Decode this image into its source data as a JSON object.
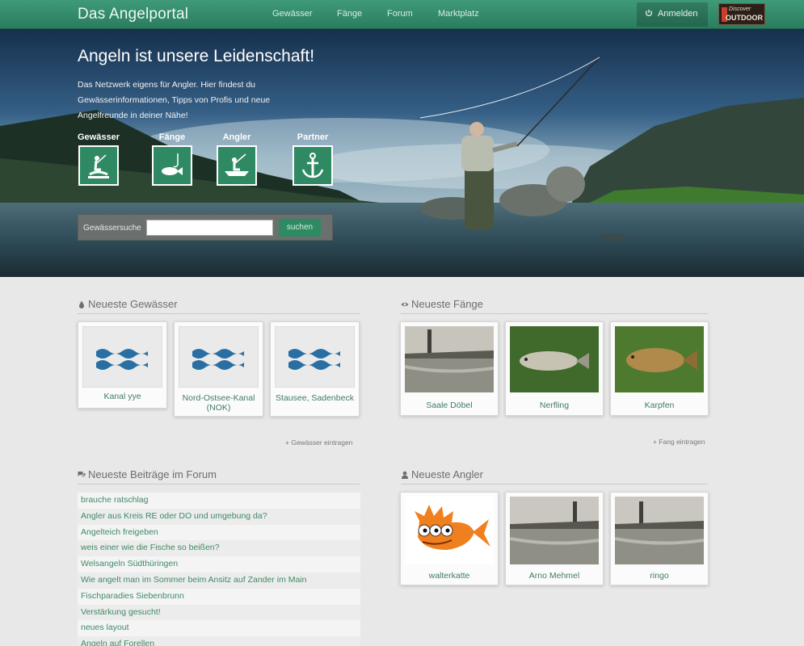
{
  "header": {
    "logo": "Das Angelportal",
    "nav": [
      "Gewässer",
      "Fänge",
      "Forum",
      "Marktplatz"
    ],
    "login": "Anmelden",
    "partner_badge": {
      "line1": "Discover",
      "line2": "OUTDOOR"
    }
  },
  "hero": {
    "title": "Angeln ist unsere Leidenschaft!",
    "description": "Das Netzwerk eigens für Angler. Hier findest du Gewässerinformationen, Tipps von Profis und neue Angelfreunde in deiner Nähe!",
    "categories": [
      {
        "label": "Gewässer",
        "icon": "angler-shore-icon"
      },
      {
        "label": "Fänge",
        "icon": "fish-catch-icon"
      },
      {
        "label": "Angler",
        "icon": "boat-angler-icon"
      },
      {
        "label": "Partner",
        "icon": "anchor-icon"
      }
    ],
    "search": {
      "label": "Gewässersuche",
      "placeholder": "",
      "value": "",
      "button": "suchen"
    }
  },
  "waters": {
    "title": "Neueste Gewässer",
    "items": [
      {
        "name": "Kanal yye"
      },
      {
        "name": "Nord-Ostsee-Kanal (NOK)"
      },
      {
        "name": "Stausee, Sadenbeck"
      }
    ],
    "add_link": "Gewässer eintragen"
  },
  "catches": {
    "title": "Neueste Fänge",
    "items": [
      {
        "name": "Saale Döbel"
      },
      {
        "name": "Nerfling"
      },
      {
        "name": "Karpfen"
      }
    ],
    "add_link": "Fang eintragen"
  },
  "forum": {
    "title": "Neueste Beiträge im Forum",
    "posts": [
      "brauche ratschlag",
      "Angler aus Kreis RE oder DO und umgebung da?",
      "Angelteich freigeben",
      "weis einer wie die Fische so beißen?",
      "Welsangeln Südthüringen",
      "Wie angelt man im Sommer beim Ansitz auf Zander im Main",
      "Fischparadies Siebenbrunn",
      "Verstärkung gesucht!",
      "neues layout",
      "Angeln auf Forellen"
    ]
  },
  "anglers": {
    "title": "Neueste Angler",
    "items": [
      {
        "name": "walterkatte"
      },
      {
        "name": "Arno Mehmel"
      },
      {
        "name": "ringo"
      }
    ]
  },
  "colors": {
    "brand_green": "#2e8a63",
    "link_green": "#3f8a66",
    "water_blue": "#2a6fa3"
  }
}
